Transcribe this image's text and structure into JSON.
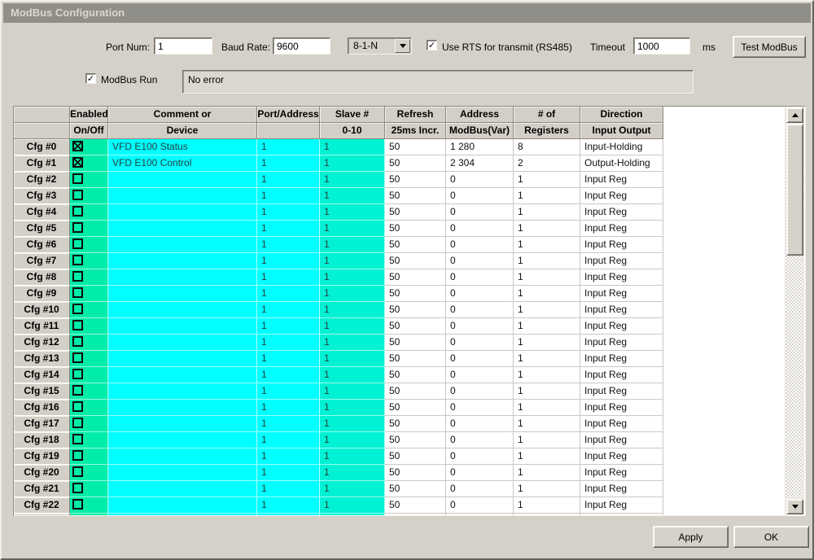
{
  "window": {
    "title": "ModBus Configuration"
  },
  "toolbar": {
    "port_num_label": "Port Num:",
    "port_num_value": "1",
    "baud_rate_label": "Baud Rate:",
    "baud_rate_value": "9600",
    "frame_format_selected": "8-1-N",
    "rts_label": "Use RTS for transmit (RS485)",
    "rts_checked": true,
    "timeout_label": "Timeout",
    "timeout_value": "1000",
    "timeout_unit": "ms",
    "test_button_label": "Test ModBus"
  },
  "run_row": {
    "modbus_run_label": "ModBus Run",
    "modbus_run_checked": true,
    "status_text": "No error"
  },
  "table": {
    "headers": [
      {
        "line1": "",
        "line2": ""
      },
      {
        "line1": "Enabled",
        "line2": "On/Off"
      },
      {
        "line1": "Comment or",
        "line2": "Device"
      },
      {
        "line1": "Port/Address",
        "line2": ""
      },
      {
        "line1": "Slave #",
        "line2": "0-10"
      },
      {
        "line1": "Refresh",
        "line2": "25ms Incr."
      },
      {
        "line1": "Address",
        "line2": "ModBus(Var)"
      },
      {
        "line1": "# of",
        "line2": "Registers"
      },
      {
        "line1": "Direction",
        "line2": "Input Output"
      }
    ],
    "rows": [
      {
        "label": "Cfg #0",
        "enabled": true,
        "comment": "VFD E100 Status",
        "port": "1",
        "slave": "1",
        "refresh": "50",
        "address": "1 280",
        "registers": "8",
        "direction": "Input-Holding"
      },
      {
        "label": "Cfg #1",
        "enabled": true,
        "comment": "VFD E100 Control",
        "port": "1",
        "slave": "1",
        "refresh": "50",
        "address": "2 304",
        "registers": "2",
        "direction": "Output-Holding"
      },
      {
        "label": "Cfg #2",
        "enabled": false,
        "comment": "",
        "port": "1",
        "slave": "1",
        "refresh": "50",
        "address": "0",
        "registers": "1",
        "direction": "Input Reg"
      },
      {
        "label": "Cfg #3",
        "enabled": false,
        "comment": "",
        "port": "1",
        "slave": "1",
        "refresh": "50",
        "address": "0",
        "registers": "1",
        "direction": "Input Reg"
      },
      {
        "label": "Cfg #4",
        "enabled": false,
        "comment": "",
        "port": "1",
        "slave": "1",
        "refresh": "50",
        "address": "0",
        "registers": "1",
        "direction": "Input Reg"
      },
      {
        "label": "Cfg #5",
        "enabled": false,
        "comment": "",
        "port": "1",
        "slave": "1",
        "refresh": "50",
        "address": "0",
        "registers": "1",
        "direction": "Input Reg"
      },
      {
        "label": "Cfg #6",
        "enabled": false,
        "comment": "",
        "port": "1",
        "slave": "1",
        "refresh": "50",
        "address": "0",
        "registers": "1",
        "direction": "Input Reg"
      },
      {
        "label": "Cfg #7",
        "enabled": false,
        "comment": "",
        "port": "1",
        "slave": "1",
        "refresh": "50",
        "address": "0",
        "registers": "1",
        "direction": "Input Reg"
      },
      {
        "label": "Cfg #8",
        "enabled": false,
        "comment": "",
        "port": "1",
        "slave": "1",
        "refresh": "50",
        "address": "0",
        "registers": "1",
        "direction": "Input Reg"
      },
      {
        "label": "Cfg #9",
        "enabled": false,
        "comment": "",
        "port": "1",
        "slave": "1",
        "refresh": "50",
        "address": "0",
        "registers": "1",
        "direction": "Input Reg"
      },
      {
        "label": "Cfg #10",
        "enabled": false,
        "comment": "",
        "port": "1",
        "slave": "1",
        "refresh": "50",
        "address": "0",
        "registers": "1",
        "direction": "Input Reg"
      },
      {
        "label": "Cfg #11",
        "enabled": false,
        "comment": "",
        "port": "1",
        "slave": "1",
        "refresh": "50",
        "address": "0",
        "registers": "1",
        "direction": "Input Reg"
      },
      {
        "label": "Cfg #12",
        "enabled": false,
        "comment": "",
        "port": "1",
        "slave": "1",
        "refresh": "50",
        "address": "0",
        "registers": "1",
        "direction": "Input Reg"
      },
      {
        "label": "Cfg #13",
        "enabled": false,
        "comment": "",
        "port": "1",
        "slave": "1",
        "refresh": "50",
        "address": "0",
        "registers": "1",
        "direction": "Input Reg"
      },
      {
        "label": "Cfg #14",
        "enabled": false,
        "comment": "",
        "port": "1",
        "slave": "1",
        "refresh": "50",
        "address": "0",
        "registers": "1",
        "direction": "Input Reg"
      },
      {
        "label": "Cfg #15",
        "enabled": false,
        "comment": "",
        "port": "1",
        "slave": "1",
        "refresh": "50",
        "address": "0",
        "registers": "1",
        "direction": "Input Reg"
      },
      {
        "label": "Cfg #16",
        "enabled": false,
        "comment": "",
        "port": "1",
        "slave": "1",
        "refresh": "50",
        "address": "0",
        "registers": "1",
        "direction": "Input Reg"
      },
      {
        "label": "Cfg #17",
        "enabled": false,
        "comment": "",
        "port": "1",
        "slave": "1",
        "refresh": "50",
        "address": "0",
        "registers": "1",
        "direction": "Input Reg"
      },
      {
        "label": "Cfg #18",
        "enabled": false,
        "comment": "",
        "port": "1",
        "slave": "1",
        "refresh": "50",
        "address": "0",
        "registers": "1",
        "direction": "Input Reg"
      },
      {
        "label": "Cfg #19",
        "enabled": false,
        "comment": "",
        "port": "1",
        "slave": "1",
        "refresh": "50",
        "address": "0",
        "registers": "1",
        "direction": "Input Reg"
      },
      {
        "label": "Cfg #20",
        "enabled": false,
        "comment": "",
        "port": "1",
        "slave": "1",
        "refresh": "50",
        "address": "0",
        "registers": "1",
        "direction": "Input Reg"
      },
      {
        "label": "Cfg #21",
        "enabled": false,
        "comment": "",
        "port": "1",
        "slave": "1",
        "refresh": "50",
        "address": "0",
        "registers": "1",
        "direction": "Input Reg"
      },
      {
        "label": "Cfg #22",
        "enabled": false,
        "comment": "",
        "port": "1",
        "slave": "1",
        "refresh": "50",
        "address": "0",
        "registers": "1",
        "direction": "Input Reg"
      }
    ]
  },
  "footer": {
    "apply_label": "Apply",
    "ok_label": "OK"
  },
  "colors": {
    "dialog_bg": "#D5D1C9",
    "titlebar_bg": "#8F8E88",
    "cell_cyan": "#00FFFF",
    "cell_enabled_green": "#00ECA9",
    "cell_slave_teal": "#00F1D3"
  }
}
